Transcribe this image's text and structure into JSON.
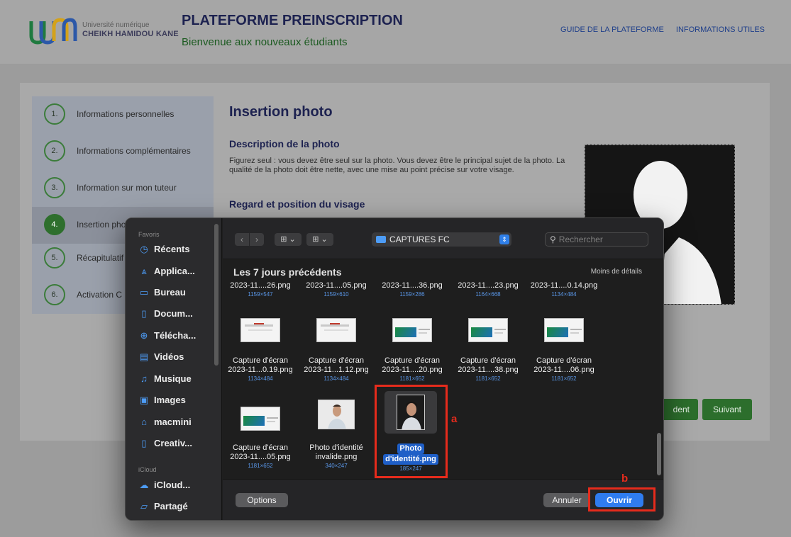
{
  "header": {
    "logo_line1": "Université numérique",
    "logo_line2": "CHEIKH HAMIDOU KANE",
    "title": "PLATEFORME PREINSCRIPTION",
    "subtitle": "Bienvenue aux nouveaux étudiants",
    "nav": [
      "GUIDE DE LA PLATEFORME",
      "INFORMATIONS UTILES"
    ]
  },
  "steps": [
    {
      "num": "1.",
      "label": "Informations personnelles"
    },
    {
      "num": "2.",
      "label": "Informations complémentaires"
    },
    {
      "num": "3.",
      "label": "Information sur mon tuteur"
    },
    {
      "num": "4.",
      "label": "Insertion photo",
      "active": true
    },
    {
      "num": "5.",
      "label": "Récapitulatif"
    },
    {
      "num": "6.",
      "label": "Activation C"
    }
  ],
  "content": {
    "title": "Insertion photo",
    "desc_title": "Description de la photo",
    "desc_text": "Figurez seul : vous devez être seul sur la photo. Vous devez être le principal sujet de la photo. La qualité de la photo doit être nette, avec une mise au point précise sur votre visage.",
    "position_title": "Regard et position du visage",
    "prev_button": "dent",
    "next_button": "Suivant"
  },
  "dialog": {
    "sidebar": {
      "favorites_label": "Favoris",
      "icloud_label": "iCloud",
      "items": [
        {
          "icon": "clock-icon",
          "glyph": "◷",
          "label": "Récents"
        },
        {
          "icon": "applications-icon",
          "glyph": "⩓",
          "label": "Applica..."
        },
        {
          "icon": "desktop-icon",
          "glyph": "▭",
          "label": "Bureau"
        },
        {
          "icon": "document-icon",
          "glyph": "▯",
          "label": "Docum..."
        },
        {
          "icon": "download-icon",
          "glyph": "⊕",
          "label": "Télécha..."
        },
        {
          "icon": "film-icon",
          "glyph": "▤",
          "label": "Vidéos"
        },
        {
          "icon": "music-icon",
          "glyph": "♫",
          "label": "Musique"
        },
        {
          "icon": "image-icon",
          "glyph": "▣",
          "label": "Images"
        },
        {
          "icon": "home-icon",
          "glyph": "⌂",
          "label": "macmini"
        },
        {
          "icon": "document-icon",
          "glyph": "▯",
          "label": "Creativ..."
        }
      ],
      "icloud_items": [
        {
          "icon": "cloud-icon",
          "glyph": "☁",
          "label": "iCloud..."
        },
        {
          "icon": "shared-folder-icon",
          "glyph": "▱",
          "label": "Partagé"
        }
      ]
    },
    "toolbar": {
      "back": "‹",
      "forward": "›",
      "view_grid": "⊞ ⌄",
      "view_group": "⊞ ⌄",
      "location": "CAPTURES FC",
      "search_placeholder": "Rechercher"
    },
    "section_header": "Les 7 jours précédents",
    "less_details": "Moins de détails",
    "files_row1": [
      {
        "name": "2023-11....26.png",
        "dims": "1159×547"
      },
      {
        "name": "2023-11....05.png",
        "dims": "1159×610"
      },
      {
        "name": "2023-11....36.png",
        "dims": "1159×286"
      },
      {
        "name": "2023-11....23.png",
        "dims": "1164×668"
      },
      {
        "name": "2023-11....0.14.png",
        "dims": "1134×484"
      }
    ],
    "files_row2": [
      {
        "line1": "Capture d'écran",
        "line2": "2023-11...0.19.png",
        "dims": "1134×484",
        "thumb": "shot"
      },
      {
        "line1": "Capture d'écran",
        "line2": "2023-11...1.12.png",
        "dims": "1134×484",
        "thumb": "shot"
      },
      {
        "line1": "Capture d'écran",
        "line2": "2023-11....20.png",
        "dims": "1181×652",
        "thumb": "banner"
      },
      {
        "line1": "Capture d'écran",
        "line2": "2023-11....38.png",
        "dims": "1181×652",
        "thumb": "banner"
      },
      {
        "line1": "Capture d'écran",
        "line2": "2023-11....06.png",
        "dims": "1181×652",
        "thumb": "banner"
      }
    ],
    "files_row3": [
      {
        "line1": "Capture d'écran",
        "line2": "2023-11....05.png",
        "dims": "1181×652",
        "thumb": "banner"
      },
      {
        "line1": "Photo d'identité",
        "line2": "invalide.png",
        "dims": "340×247",
        "thumb": "photo-wide"
      },
      {
        "line1": "Photo",
        "line2": "d'identité.png",
        "dims": "185×247",
        "thumb": "photo-portrait",
        "selected": true
      }
    ],
    "footer": {
      "options": "Options",
      "cancel": "Annuler",
      "open": "Ouvrir"
    }
  },
  "annotations": {
    "a": "a",
    "b": "b",
    "color": "#e62b1c"
  }
}
